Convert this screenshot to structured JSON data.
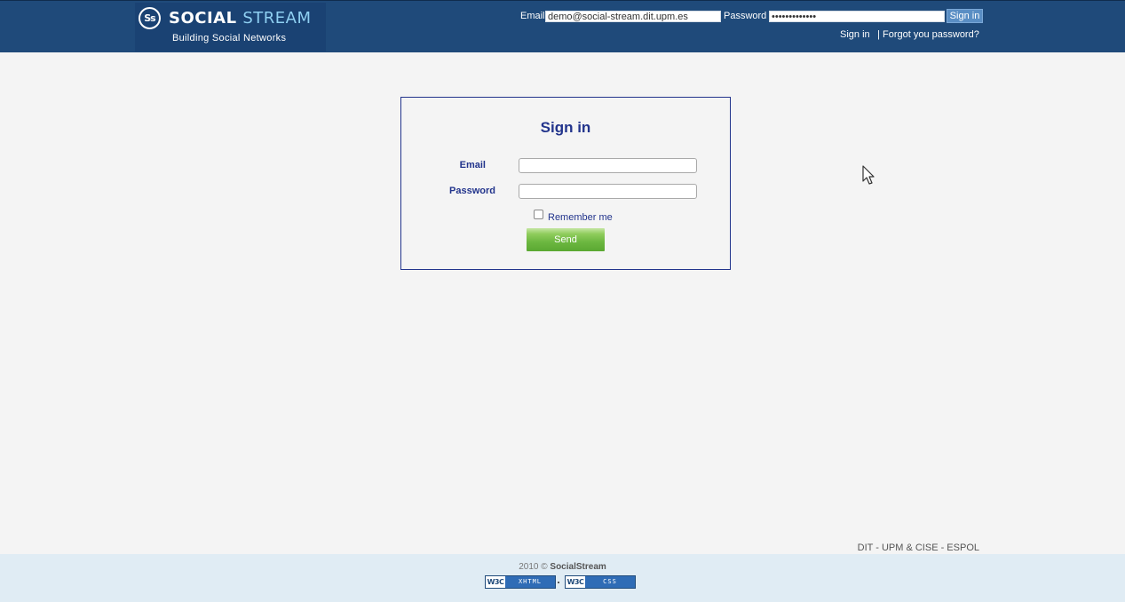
{
  "header": {
    "logo": {
      "mark": "Ss",
      "name_part1": "SOCIAL",
      "name_part2": "STREAM",
      "tagline": "Building Social Networks"
    },
    "email_label": "Email",
    "email_value": "demo@social-stream.dit.upm.es",
    "password_label": "Password",
    "password_value": "demonstration",
    "signin_button": "Sign in",
    "signin_link": "Sign in",
    "separator": "|",
    "forgot_link": "Forgot you password?"
  },
  "signin_form": {
    "title": "Sign in",
    "email_label": "Email",
    "email_value": "",
    "password_label": "Password",
    "password_value": "",
    "remember_label": "Remember me",
    "remember_checked": false,
    "send_button": "Send"
  },
  "footer": {
    "credits": "DIT - UPM & CISE - ESPOL",
    "copyright_year": "2010 ©",
    "copyright_brand": "SocialStream",
    "badges": [
      {
        "logo": "W3C",
        "kind": "XHTML"
      },
      {
        "logo": "W3C",
        "kind": "CSS"
      }
    ]
  },
  "colors": {
    "header_bg": "#1f4a7a",
    "accent_blue": "#22348c",
    "send_green": "#6cb740",
    "footer_bg": "#e0ecf4",
    "page_bg": "#f4f4f4"
  },
  "icons": {
    "cursor": "mouse-pointer-icon"
  }
}
